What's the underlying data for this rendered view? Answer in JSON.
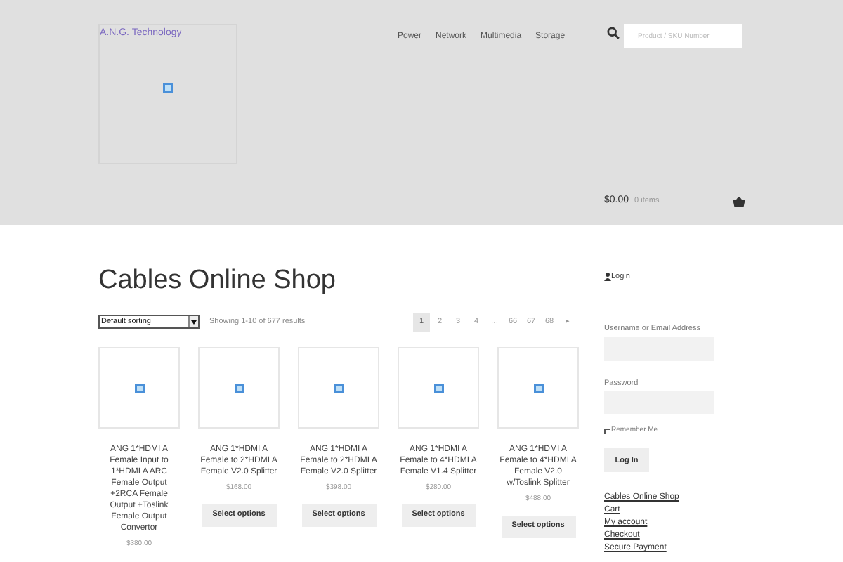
{
  "header": {
    "site_title": "A.N.G. Technology",
    "nav": [
      "Power",
      "Network",
      "Multimedia",
      "Storage"
    ],
    "search": {
      "placeholder": "Product / SKU Number"
    },
    "cart": {
      "total": "$0.00",
      "count": "0 items"
    }
  },
  "main": {
    "title": "Cables Online Shop",
    "sort": {
      "value": "Default sorting"
    },
    "result_count": "Showing 1-10 of 677 results",
    "pagination": [
      {
        "label": "1",
        "selected": true
      },
      {
        "label": "2",
        "selected": false
      },
      {
        "label": "3",
        "selected": false
      },
      {
        "label": "4",
        "selected": false
      },
      {
        "label": "…",
        "selected": false
      },
      {
        "label": "66",
        "selected": false
      },
      {
        "label": "67",
        "selected": false
      },
      {
        "label": "68",
        "selected": false
      },
      {
        "label": "▸",
        "selected": false
      }
    ],
    "products": [
      {
        "title": "ANG 1*HDMI A Female Input to 1*HDMI A ARC Female Output +2RCA Female Output +Toslink Female Output Convertor",
        "price": "$380.00"
      },
      {
        "title": "ANG 1*HDMI A Female to 2*HDMI A Female V2.0 Splitter",
        "price": "$168.00",
        "button": "Select options"
      },
      {
        "title": "ANG 1*HDMI A Female to 2*HDMI A Female V2.0 Splitter",
        "price": "$398.00",
        "button": "Select options"
      },
      {
        "title": "ANG 1*HDMI A Female to 4*HDMI A Female V1.4 Splitter",
        "price": "$280.00",
        "button": "Select options"
      },
      {
        "title": "ANG 1*HDMI A Female to 4*HDMI A Female V2.0 w/Toslink Splitter",
        "price": "$488.00",
        "button": "Select options"
      }
    ]
  },
  "sidebar": {
    "login_title": "Login",
    "fields": [
      {
        "label": "Username or Email Address"
      },
      {
        "label": "Password"
      }
    ],
    "remember": {
      "label": "Remember Me",
      "checked": false
    },
    "login_button": "Log In",
    "links": [
      "Cables Online Shop",
      "Cart",
      "My account",
      "Checkout",
      "Secure Payment"
    ]
  }
}
